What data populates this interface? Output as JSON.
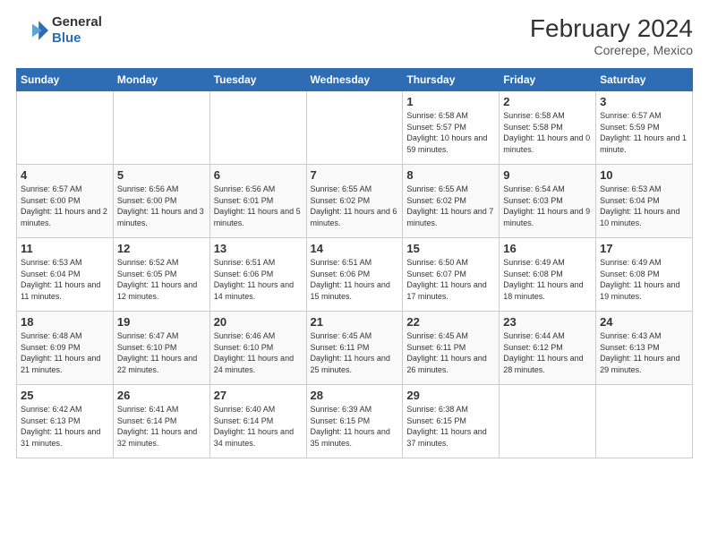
{
  "header": {
    "logo_line1": "General",
    "logo_line2": "Blue",
    "month_year": "February 2024",
    "location": "Corerepe, Mexico"
  },
  "weekdays": [
    "Sunday",
    "Monday",
    "Tuesday",
    "Wednesday",
    "Thursday",
    "Friday",
    "Saturday"
  ],
  "weeks": [
    [
      {
        "day": "",
        "info": ""
      },
      {
        "day": "",
        "info": ""
      },
      {
        "day": "",
        "info": ""
      },
      {
        "day": "",
        "info": ""
      },
      {
        "day": "1",
        "info": "Sunrise: 6:58 AM\nSunset: 5:57 PM\nDaylight: 10 hours and 59 minutes."
      },
      {
        "day": "2",
        "info": "Sunrise: 6:58 AM\nSunset: 5:58 PM\nDaylight: 11 hours and 0 minutes."
      },
      {
        "day": "3",
        "info": "Sunrise: 6:57 AM\nSunset: 5:59 PM\nDaylight: 11 hours and 1 minute."
      }
    ],
    [
      {
        "day": "4",
        "info": "Sunrise: 6:57 AM\nSunset: 6:00 PM\nDaylight: 11 hours and 2 minutes."
      },
      {
        "day": "5",
        "info": "Sunrise: 6:56 AM\nSunset: 6:00 PM\nDaylight: 11 hours and 3 minutes."
      },
      {
        "day": "6",
        "info": "Sunrise: 6:56 AM\nSunset: 6:01 PM\nDaylight: 11 hours and 5 minutes."
      },
      {
        "day": "7",
        "info": "Sunrise: 6:55 AM\nSunset: 6:02 PM\nDaylight: 11 hours and 6 minutes."
      },
      {
        "day": "8",
        "info": "Sunrise: 6:55 AM\nSunset: 6:02 PM\nDaylight: 11 hours and 7 minutes."
      },
      {
        "day": "9",
        "info": "Sunrise: 6:54 AM\nSunset: 6:03 PM\nDaylight: 11 hours and 9 minutes."
      },
      {
        "day": "10",
        "info": "Sunrise: 6:53 AM\nSunset: 6:04 PM\nDaylight: 11 hours and 10 minutes."
      }
    ],
    [
      {
        "day": "11",
        "info": "Sunrise: 6:53 AM\nSunset: 6:04 PM\nDaylight: 11 hours and 11 minutes."
      },
      {
        "day": "12",
        "info": "Sunrise: 6:52 AM\nSunset: 6:05 PM\nDaylight: 11 hours and 12 minutes."
      },
      {
        "day": "13",
        "info": "Sunrise: 6:51 AM\nSunset: 6:06 PM\nDaylight: 11 hours and 14 minutes."
      },
      {
        "day": "14",
        "info": "Sunrise: 6:51 AM\nSunset: 6:06 PM\nDaylight: 11 hours and 15 minutes."
      },
      {
        "day": "15",
        "info": "Sunrise: 6:50 AM\nSunset: 6:07 PM\nDaylight: 11 hours and 17 minutes."
      },
      {
        "day": "16",
        "info": "Sunrise: 6:49 AM\nSunset: 6:08 PM\nDaylight: 11 hours and 18 minutes."
      },
      {
        "day": "17",
        "info": "Sunrise: 6:49 AM\nSunset: 6:08 PM\nDaylight: 11 hours and 19 minutes."
      }
    ],
    [
      {
        "day": "18",
        "info": "Sunrise: 6:48 AM\nSunset: 6:09 PM\nDaylight: 11 hours and 21 minutes."
      },
      {
        "day": "19",
        "info": "Sunrise: 6:47 AM\nSunset: 6:10 PM\nDaylight: 11 hours and 22 minutes."
      },
      {
        "day": "20",
        "info": "Sunrise: 6:46 AM\nSunset: 6:10 PM\nDaylight: 11 hours and 24 minutes."
      },
      {
        "day": "21",
        "info": "Sunrise: 6:45 AM\nSunset: 6:11 PM\nDaylight: 11 hours and 25 minutes."
      },
      {
        "day": "22",
        "info": "Sunrise: 6:45 AM\nSunset: 6:11 PM\nDaylight: 11 hours and 26 minutes."
      },
      {
        "day": "23",
        "info": "Sunrise: 6:44 AM\nSunset: 6:12 PM\nDaylight: 11 hours and 28 minutes."
      },
      {
        "day": "24",
        "info": "Sunrise: 6:43 AM\nSunset: 6:13 PM\nDaylight: 11 hours and 29 minutes."
      }
    ],
    [
      {
        "day": "25",
        "info": "Sunrise: 6:42 AM\nSunset: 6:13 PM\nDaylight: 11 hours and 31 minutes."
      },
      {
        "day": "26",
        "info": "Sunrise: 6:41 AM\nSunset: 6:14 PM\nDaylight: 11 hours and 32 minutes."
      },
      {
        "day": "27",
        "info": "Sunrise: 6:40 AM\nSunset: 6:14 PM\nDaylight: 11 hours and 34 minutes."
      },
      {
        "day": "28",
        "info": "Sunrise: 6:39 AM\nSunset: 6:15 PM\nDaylight: 11 hours and 35 minutes."
      },
      {
        "day": "29",
        "info": "Sunrise: 6:38 AM\nSunset: 6:15 PM\nDaylight: 11 hours and 37 minutes."
      },
      {
        "day": "",
        "info": ""
      },
      {
        "day": "",
        "info": ""
      }
    ]
  ]
}
